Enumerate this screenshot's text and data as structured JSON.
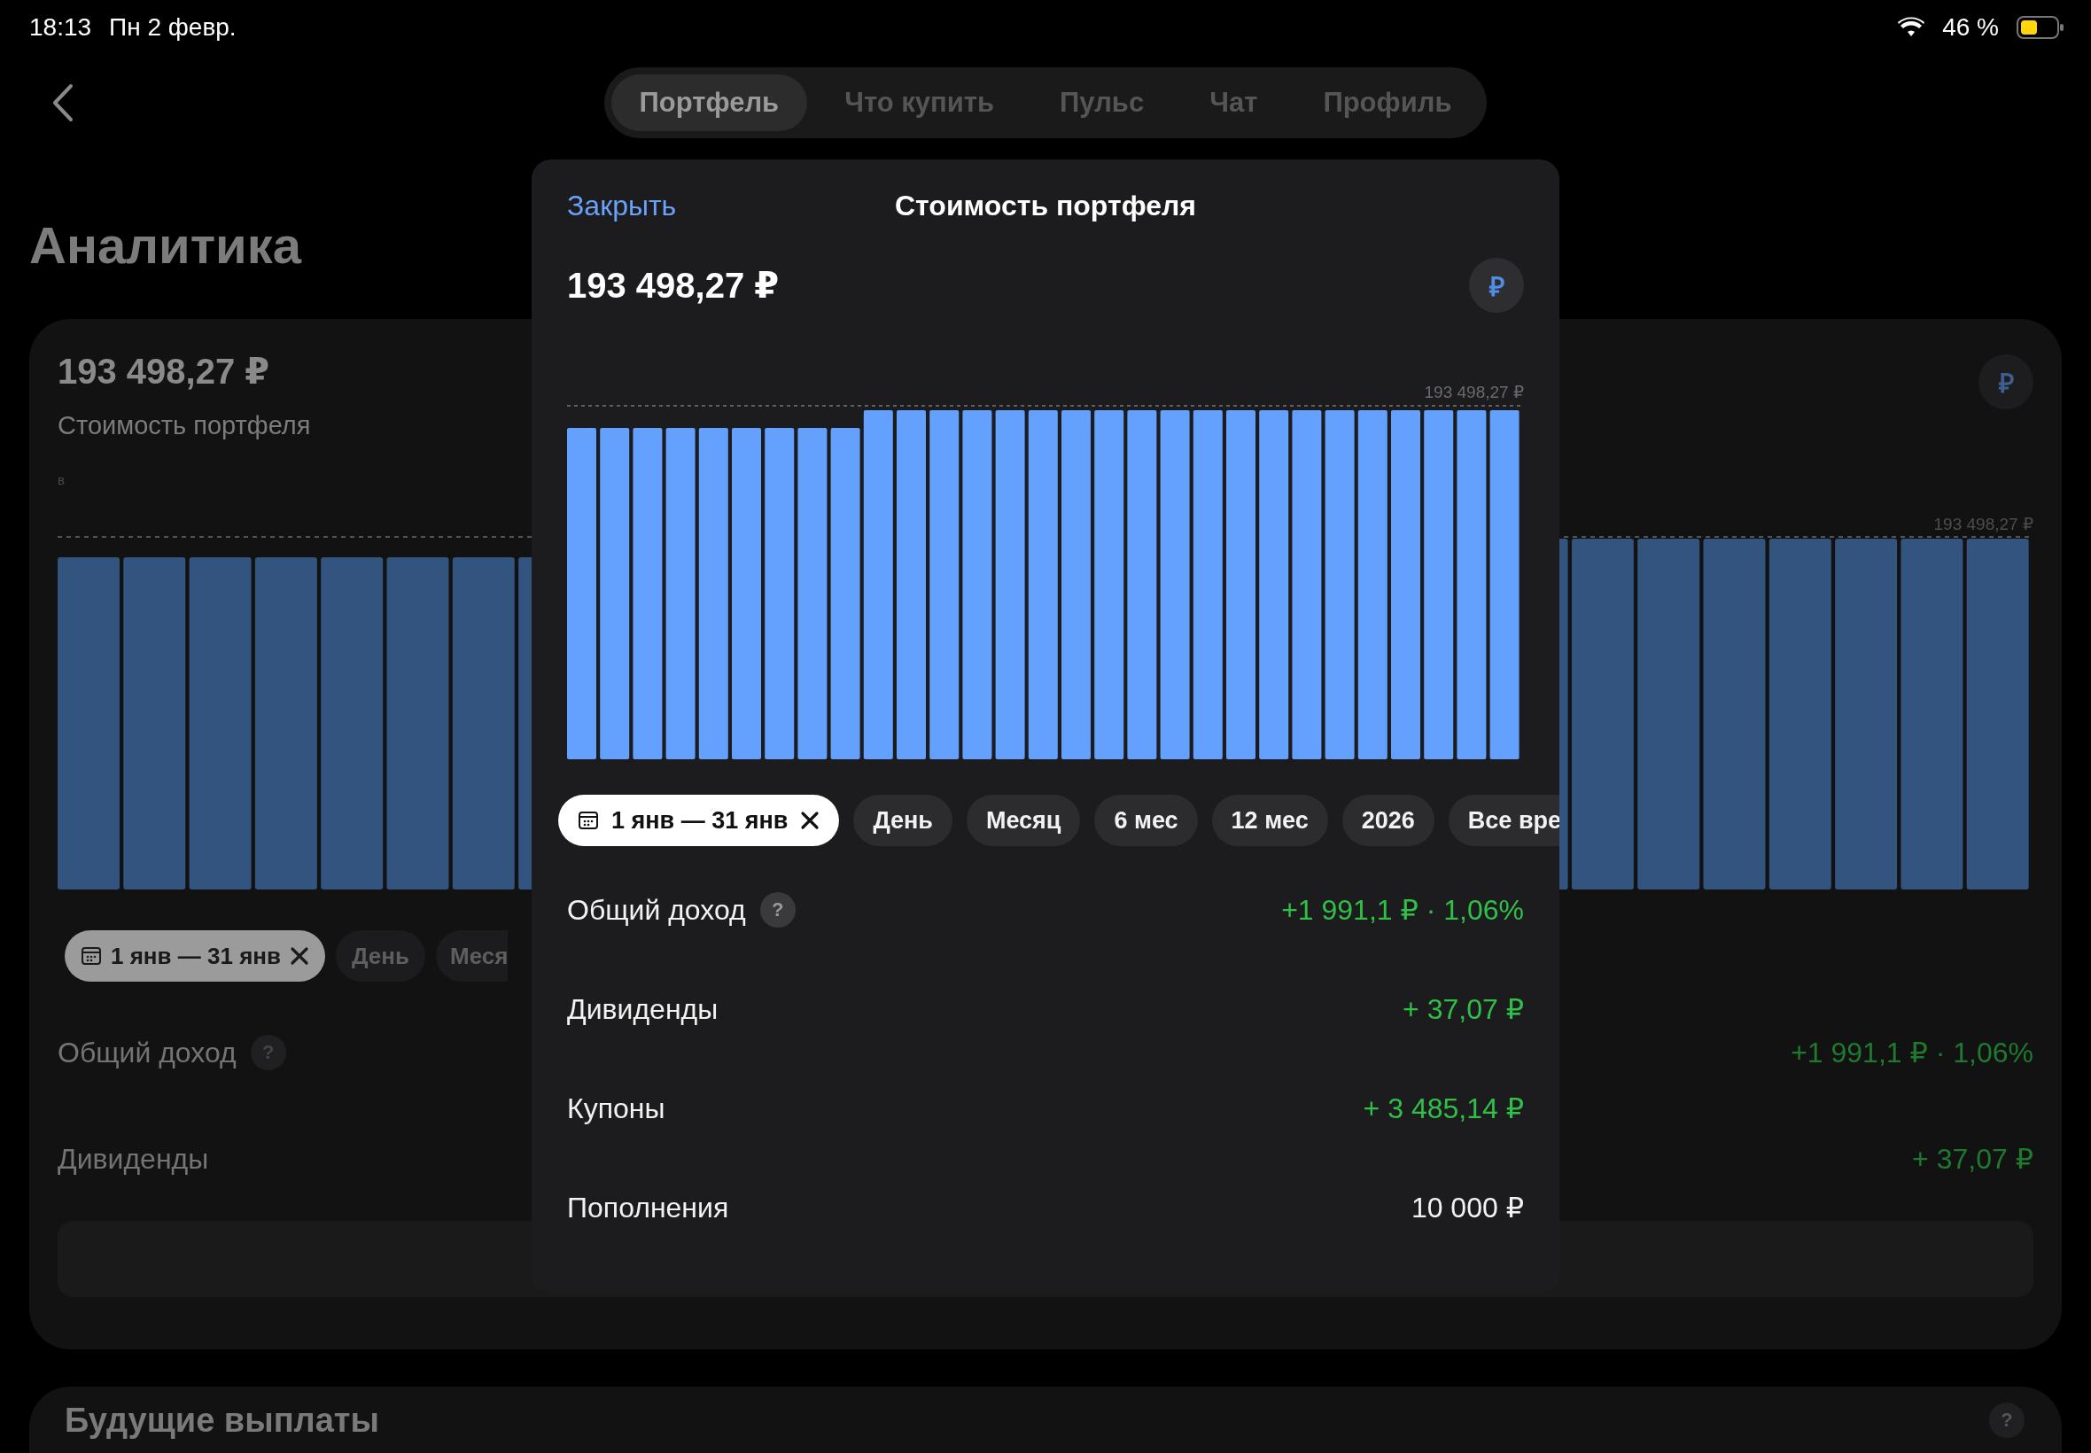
{
  "status_bar": {
    "time": "18:13",
    "date": "Пн 2 февр.",
    "battery": "46 %"
  },
  "tabs": [
    {
      "label": "Портфель",
      "selected": true
    },
    {
      "label": "Что купить",
      "selected": false
    },
    {
      "label": "Пульс",
      "selected": false
    },
    {
      "label": "Чат",
      "selected": false
    },
    {
      "label": "Профиль",
      "selected": false
    }
  ],
  "page_title": "Аналитика",
  "analytics_card": {
    "value": "193 498,27 ₽",
    "subtitle": "Стоимость портфеля",
    "axis_note": "в",
    "currency": "₽",
    "chart_label": "193 498,27 ₽",
    "chips": [
      {
        "label": "1 янв — 31 янв",
        "kind": "range",
        "selected": true
      },
      {
        "label": "День",
        "kind": "period",
        "selected": false
      },
      {
        "label": "Меся",
        "kind": "period",
        "selected": false
      }
    ],
    "rows": [
      {
        "label": "Общий доход",
        "help": "?",
        "value": "+1 991,1 ₽ · 1,06%",
        "color": "#1e7a2e"
      },
      {
        "label": "Дивиденды",
        "value": "+ 37,07 ₽",
        "color": "#1e7a2e"
      }
    ]
  },
  "future_payments": {
    "title": "Будущие выплаты",
    "help": "?"
  },
  "modal": {
    "close": "Закрыть",
    "title": "Стоимость портфеля",
    "value": "193 498,27 ₽",
    "currency": "₽",
    "chart_label": "193 498,27 ₽",
    "chips": [
      {
        "label": "1 янв — 31 янв",
        "kind": "range",
        "selected": true
      },
      {
        "label": "День",
        "kind": "period",
        "selected": false
      },
      {
        "label": "Месяц",
        "kind": "period",
        "selected": false
      },
      {
        "label": "6 мес",
        "kind": "period",
        "selected": false
      },
      {
        "label": "12 мес",
        "kind": "period",
        "selected": false
      },
      {
        "label": "2026",
        "kind": "period",
        "selected": false
      },
      {
        "label": "Все вре",
        "kind": "period",
        "selected": false
      }
    ],
    "rows": [
      {
        "label": "Общий доход",
        "help": "?",
        "value": "+1 991,1 ₽ · 1,06%",
        "color": "#30c048"
      },
      {
        "label": "Дивиденды",
        "value": "+ 37,07 ₽",
        "color": "#30c048"
      },
      {
        "label": "Купоны",
        "value": "+ 3 485,14 ₽",
        "color": "#30c048"
      },
      {
        "label": "Пополнения",
        "value": "10 000 ₽",
        "color": "#f2f2f2"
      }
    ]
  }
}
